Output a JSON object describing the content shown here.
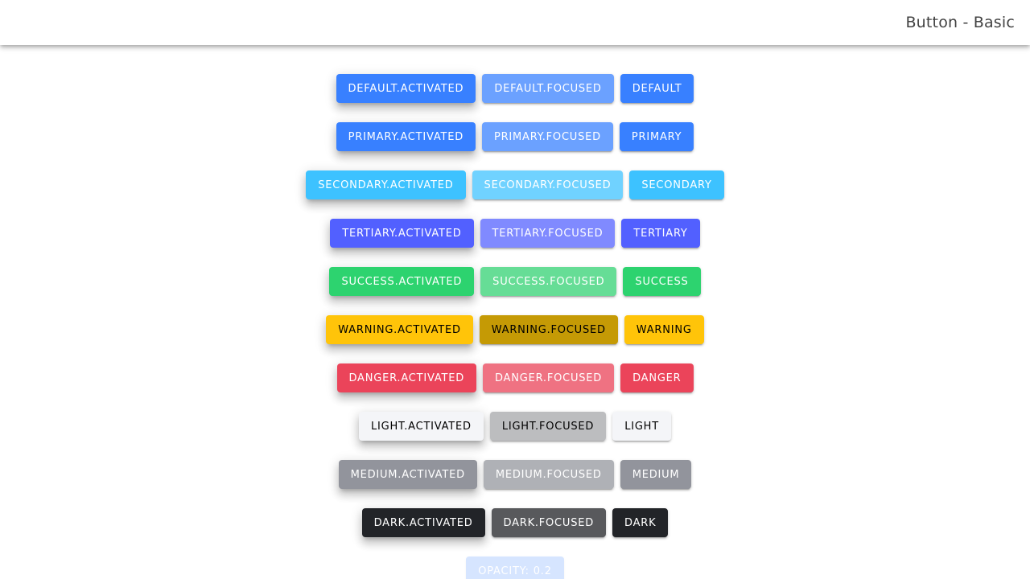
{
  "header": {
    "title": "Button - Basic"
  },
  "colors": {
    "primary": "#3880ff",
    "primary_focused": "#6ba1ff",
    "secondary": "#3dc2ff",
    "secondary_focused": "#70d2ff",
    "tertiary": "#5260ff",
    "tertiary_focused": "#808aff",
    "success": "#2dd36f",
    "success_focused": "#66dd96",
    "warning": "#ffc409",
    "warning_focused": "#c59a05",
    "danger": "#eb445a",
    "danger_focused": "#ef7282",
    "light": "#f4f5f8",
    "light_focused": "#bcbdbf",
    "medium": "#92949c",
    "medium_focused": "#afb1b6",
    "dark": "#222428",
    "dark_focused": "#58595c"
  },
  "rows": [
    {
      "activated": "DEFAULT.ACTIVATED",
      "focused": "DEFAULT.FOCUSED",
      "plain": "DEFAULT"
    },
    {
      "activated": "PRIMARY.ACTIVATED",
      "focused": "PRIMARY.FOCUSED",
      "plain": "PRIMARY"
    },
    {
      "activated": "SECONDARY.ACTIVATED",
      "focused": "SECONDARY.FOCUSED",
      "plain": "SECONDARY"
    },
    {
      "activated": "TERTIARY.ACTIVATED",
      "focused": "TERTIARY.FOCUSED",
      "plain": "TERTIARY"
    },
    {
      "activated": "SUCCESS.ACTIVATED",
      "focused": "SUCCESS.FOCUSED",
      "plain": "SUCCESS"
    },
    {
      "activated": "WARNING.ACTIVATED",
      "focused": "WARNING.FOCUSED",
      "plain": "WARNING"
    },
    {
      "activated": "DANGER.ACTIVATED",
      "focused": "DANGER.FOCUSED",
      "plain": "DANGER"
    },
    {
      "activated": "LIGHT.ACTIVATED",
      "focused": "LIGHT.FOCUSED",
      "plain": "LIGHT"
    },
    {
      "activated": "MEDIUM.ACTIVATED",
      "focused": "MEDIUM.FOCUSED",
      "plain": "MEDIUM"
    },
    {
      "activated": "DARK.ACTIVATED",
      "focused": "DARK.FOCUSED",
      "plain": "DARK"
    }
  ],
  "opacity_button": {
    "label": "OPACITY: 0.2",
    "opacity": 0.2
  }
}
